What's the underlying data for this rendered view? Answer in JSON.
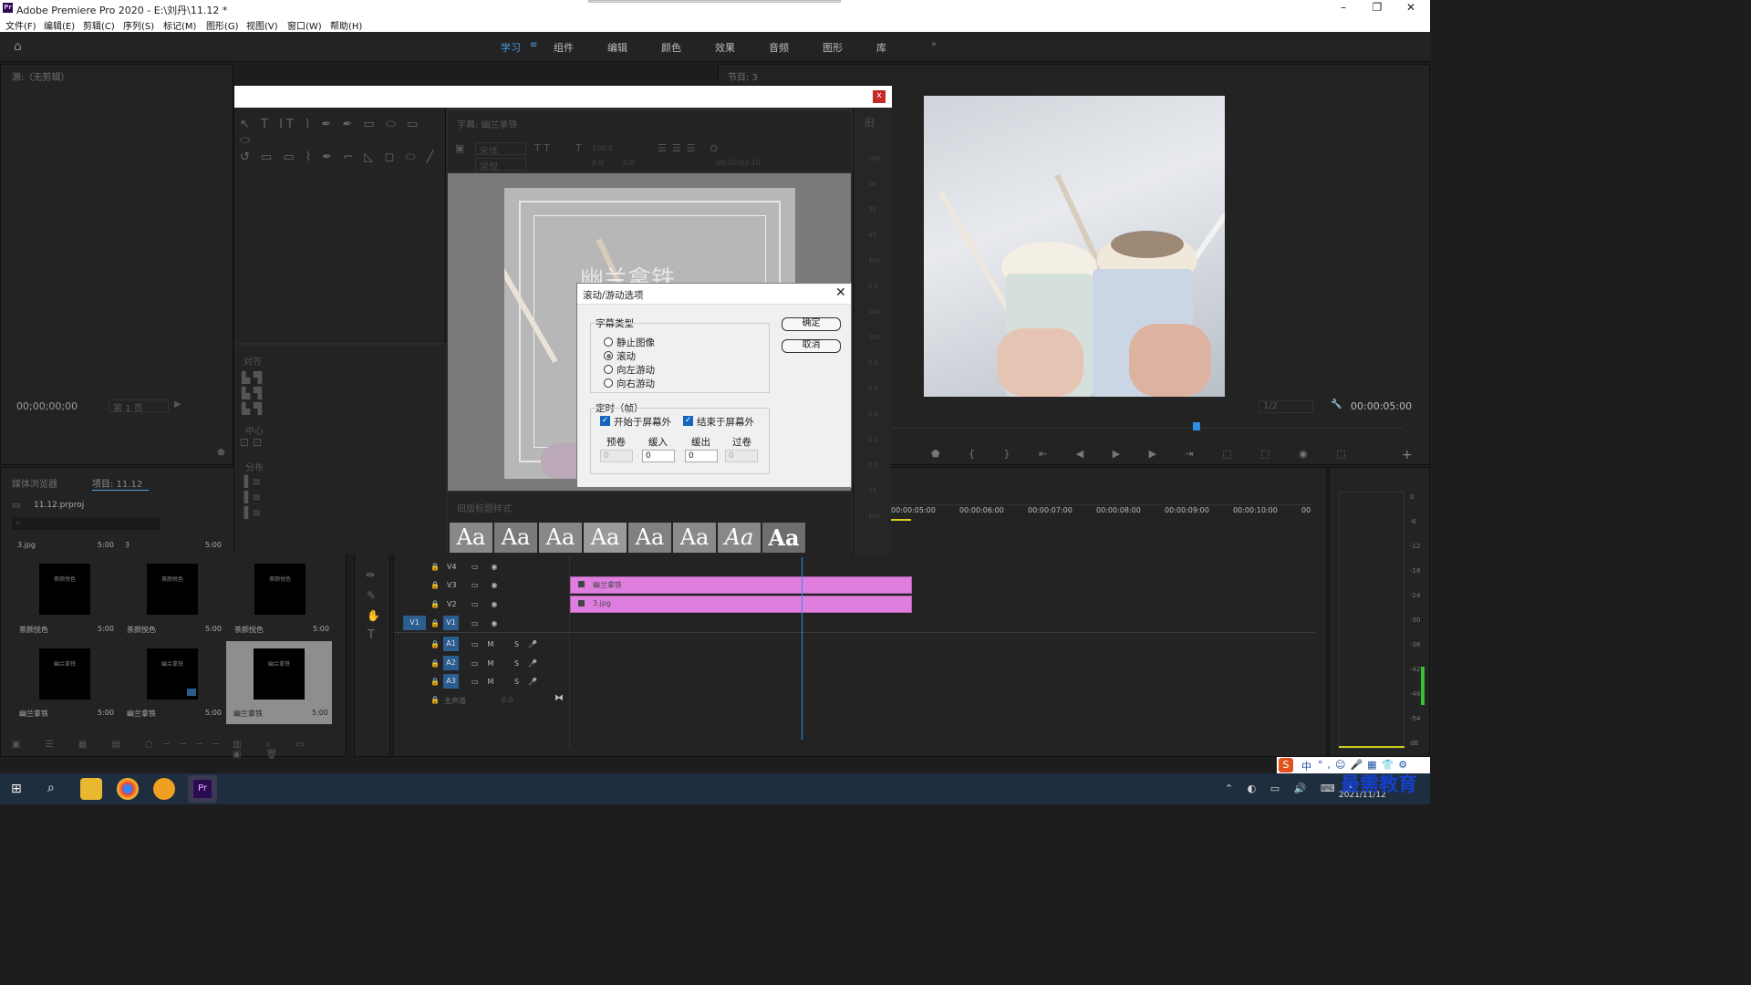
{
  "window": {
    "title": "Adobe Premiere Pro 2020 - E:\\刘丹\\11.12 *",
    "app_badge": "Pr"
  },
  "menu": [
    "文件(F)",
    "编辑(E)",
    "剪辑(C)",
    "序列(S)",
    "标记(M)",
    "图形(G)",
    "视图(V)",
    "窗口(W)",
    "帮助(H)"
  ],
  "workspaces": [
    "学习",
    "组件",
    "编辑",
    "颜色",
    "效果",
    "音频",
    "图形",
    "库"
  ],
  "source_panel": {
    "title": "源:（无剪辑）",
    "timecode": "00;00;00;00",
    "page": "第 1 页"
  },
  "program_panel": {
    "title": "节目: 3",
    "timecode": "00:00:05:00",
    "fit": "1/2"
  },
  "titler": {
    "panel_title": "字幕: 幽兰拿铁",
    "font": "宋体",
    "style": "常规",
    "size_values": [
      "100.0",
      "0.0",
      "0.0"
    ],
    "duration": "00:00:03:10",
    "canvas_text": "幽兰拿铁",
    "align_label": "对齐",
    "center_label": "中心",
    "distribute_label": "分布",
    "styles_title": "旧版标题样式",
    "style_samples": [
      "Aa",
      "Aa",
      "Aa",
      "Aa",
      "Aa",
      "Aa",
      "Aa",
      "Aa"
    ],
    "right_values": [
      "100",
      "56",
      "38",
      "47",
      "100",
      "0.0",
      "100",
      "100",
      "0.0",
      "0.0",
      "0.0",
      "0.0",
      "0.0",
      "75",
      "100"
    ]
  },
  "roll_dialog": {
    "title": "滚动/游动选项",
    "type_group": "字幕类型",
    "options": [
      {
        "label": "静止图像",
        "selected": false
      },
      {
        "label": "滚动",
        "selected": true
      },
      {
        "label": "向左游动",
        "selected": false
      },
      {
        "label": "向右游动",
        "selected": false
      }
    ],
    "timing_group": "定时（帧）",
    "start_off": "开始于屏幕外",
    "end_off": "结束于屏幕外",
    "fields": [
      {
        "label": "预卷",
        "value": "0",
        "disabled": true
      },
      {
        "label": "缓入",
        "value": "0",
        "disabled": false
      },
      {
        "label": "缓出",
        "value": "0",
        "disabled": false
      },
      {
        "label": "过卷",
        "value": "0",
        "disabled": true
      }
    ],
    "ok": "确定",
    "cancel": "取消"
  },
  "project_panel": {
    "tabs": [
      "媒体浏览器",
      "项目: 11.12"
    ],
    "file": "11.12.prproj",
    "col_items": [
      {
        "name": "3.jpg",
        "dur": "5:00"
      },
      {
        "name": "3",
        "dur": "5:00"
      }
    ],
    "items": [
      {
        "name": "茶颜悦色",
        "dur": "5:00",
        "thumb": "茶颜悦色"
      },
      {
        "name": "茶颜悦色",
        "dur": "5:00",
        "thumb": "茶颜悦色"
      },
      {
        "name": "茶颜悦色",
        "dur": "5:00",
        "thumb": "茶颜悦色"
      },
      {
        "name": "幽兰拿铁",
        "dur": "5:00",
        "thumb": "幽兰拿铁"
      },
      {
        "name": "幽兰拿铁",
        "dur": "5:00",
        "thumb": "幽兰拿铁"
      },
      {
        "name": "幽兰拿铁",
        "dur": "5:00",
        "thumb": "幽兰拿铁"
      }
    ]
  },
  "timeline": {
    "ruler": [
      "00:00:05:00",
      "00:00:06:00",
      "00:00:07:00",
      "00:00:08:00",
      "00:00:09:00",
      "00:00:10:00",
      "00"
    ],
    "video_tracks": [
      "V4",
      "V3",
      "V2",
      "V1"
    ],
    "audio_tracks": [
      "A1",
      "A2",
      "A3"
    ],
    "master": "主声道",
    "master_value": "0.0",
    "source_patch": "V1",
    "clips": [
      {
        "track": "V3",
        "name": "幽兰拿铁"
      },
      {
        "track": "V2",
        "name": "3.jpg"
      }
    ]
  },
  "meter": {
    "scale": [
      "0",
      "-6",
      "-12",
      "-18",
      "-24",
      "-30",
      "-36",
      "-42",
      "-48",
      "-54",
      "dB"
    ]
  },
  "taskbar": {
    "date": "2021/11/12",
    "watermark": "最需教育",
    "ime": "中"
  },
  "colors": {
    "accent": "#4d9de0",
    "clip": "#e07ee0",
    "track_btn": "#2c5d8f"
  }
}
